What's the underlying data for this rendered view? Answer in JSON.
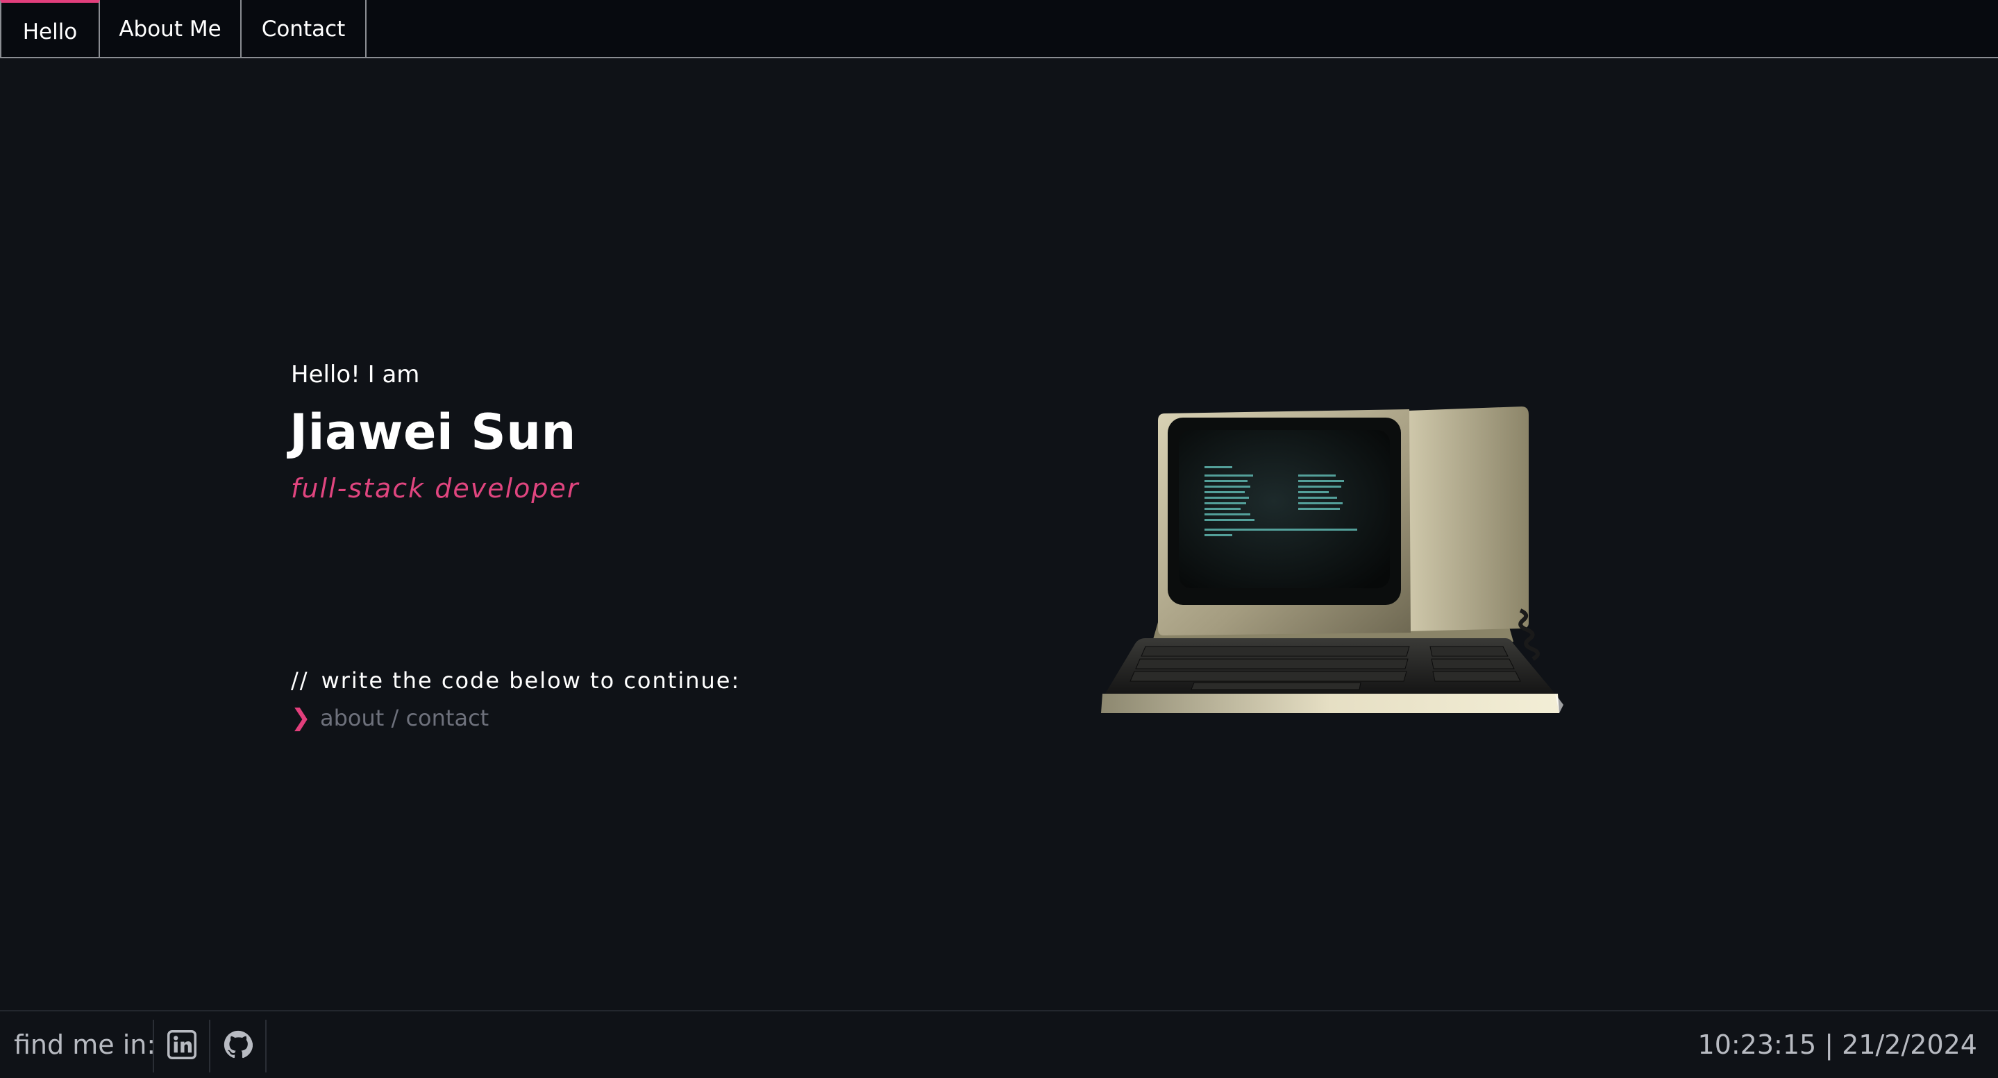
{
  "nav": {
    "tabs": [
      {
        "label": "Hello",
        "active": true
      },
      {
        "label": "About Me",
        "active": false
      },
      {
        "label": "Contact",
        "active": false
      }
    ]
  },
  "hero": {
    "greeting": "Hello! I am",
    "name": "Jiawei Sun",
    "role": "full-stack developer"
  },
  "prompt": {
    "comment_prefix": "//",
    "comment_text": "write the code below to continue:",
    "arrow_icon": "chevron-right-icon",
    "placeholder": "about / contact"
  },
  "footer": {
    "find_me_label": "find me in:",
    "socials": [
      {
        "icon": "linkedin-icon"
      },
      {
        "icon": "github-icon"
      }
    ],
    "clock": "10:23:15 | 21/2/2024"
  },
  "colors": {
    "accent": "#e23f7c",
    "background": "#0f1217",
    "topbar": "#070a0f",
    "muted_text": "#b8bbc2"
  }
}
